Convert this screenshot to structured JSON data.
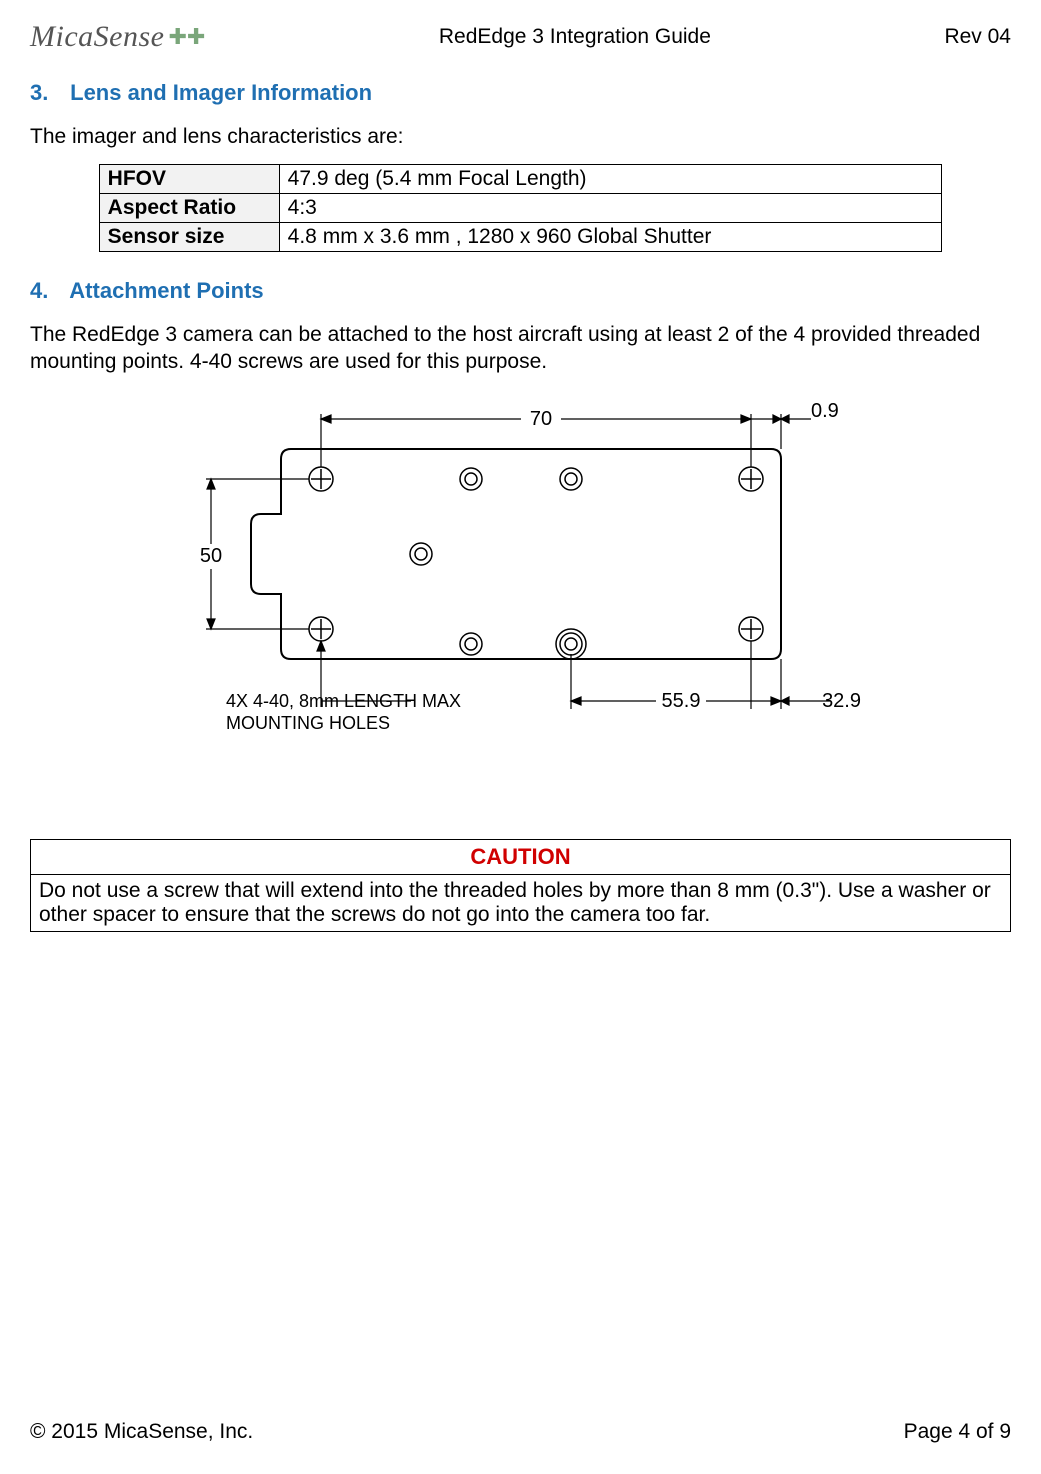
{
  "header": {
    "logo_text": "MicaSense",
    "title": "RedEdge 3 Integration Guide",
    "rev": "Rev 04"
  },
  "section3": {
    "number": "3.",
    "title": "Lens and Imager Information",
    "intro": "The imager and lens characteristics are:",
    "rows": [
      {
        "label": "HFOV",
        "value": " 47.9 deg (5.4 mm Focal Length)"
      },
      {
        "label": "Aspect Ratio",
        "value": " 4:3"
      },
      {
        "label": "Sensor size",
        "value": "4.8 mm x 3.6 mm , 1280 x 960 Global Shutter"
      }
    ]
  },
  "section4": {
    "number": "4.",
    "title": "Attachment Points",
    "intro": "The RedEdge 3 camera can be attached to the host aircraft using at least 2 of the 4 provided threaded mounting points. 4-40 screws are used for this purpose."
  },
  "diagram": {
    "dim_top": "70",
    "dim_top_right": "0.9",
    "dim_left": "50",
    "dim_bottom": "55.9",
    "dim_right": "32.9",
    "note_line1": "4X 4-40, 8mm LENGTH MAX",
    "note_line2": "MOUNTING HOLES"
  },
  "caution": {
    "heading": "CAUTION",
    "body": "Do not use a screw that will extend into the threaded holes by more than 8 mm (0.3\"). Use a washer or other spacer to ensure that the screws do not go into the camera too far."
  },
  "footer": {
    "left": "© 2015 MicaSense, Inc.",
    "right": "Page 4 of 9"
  }
}
